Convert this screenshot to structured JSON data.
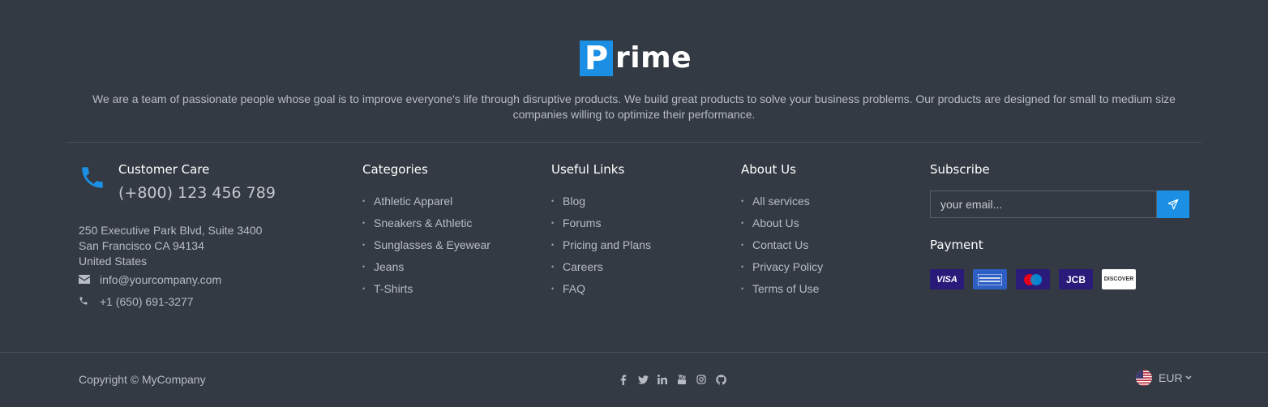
{
  "brand": {
    "logo_letter": "P",
    "logo_rest": "rime",
    "tagline": "We are a team of passionate people whose goal is to improve everyone's life through disruptive products. We build great products to solve your business problems. Our products are designed for small to medium size companies willing to optimize their performance."
  },
  "customer_care": {
    "title": "Customer Care",
    "phone_main": "(+800) 123 456 789",
    "address_line1": "250 Executive Park Blvd, Suite 3400",
    "address_line2": "San Francisco CA 94134",
    "address_line3": "United States",
    "email": "info@yourcompany.com",
    "phone": "+1 (650) 691-3277"
  },
  "categories": {
    "title": "Categories",
    "items": [
      "Athletic Apparel",
      "Sneakers & Athletic",
      "Sunglasses & Eyewear",
      "Jeans",
      "T-Shirts"
    ]
  },
  "useful_links": {
    "title": "Useful Links",
    "items": [
      "Blog",
      "Forums",
      "Pricing and Plans",
      "Careers",
      "FAQ"
    ]
  },
  "about_us": {
    "title": "About Us",
    "items": [
      "All services",
      "About Us",
      "Contact Us",
      "Privacy Policy",
      "Terms of Use"
    ]
  },
  "subscribe": {
    "title": "Subscribe",
    "placeholder": "your email..."
  },
  "payment": {
    "title": "Payment",
    "cards": [
      {
        "name": "visa-card-icon",
        "label": "VISA",
        "color": "#1a1f71"
      },
      {
        "name": "amex-card-icon",
        "label": "AMEX",
        "color": "#2e77bb"
      },
      {
        "name": "maestro-card-icon",
        "label": "Maestro",
        "color": "#2b2f7d"
      },
      {
        "name": "jcb-card-icon",
        "label": "JCB",
        "color": "#27248a"
      },
      {
        "name": "discover-card-icon",
        "label": "DISCOVER",
        "color": "#ffffff"
      }
    ]
  },
  "footer": {
    "copyright": "Copyright © MyCompany",
    "currency": "EUR",
    "social_icons": [
      "facebook-icon",
      "twitter-icon",
      "linkedin-icon",
      "youtube-icon",
      "instagram-icon",
      "github-icon"
    ]
  },
  "colors": {
    "background": "#343a43",
    "accent": "#1a8fe3",
    "text": "#b7bcc4"
  }
}
